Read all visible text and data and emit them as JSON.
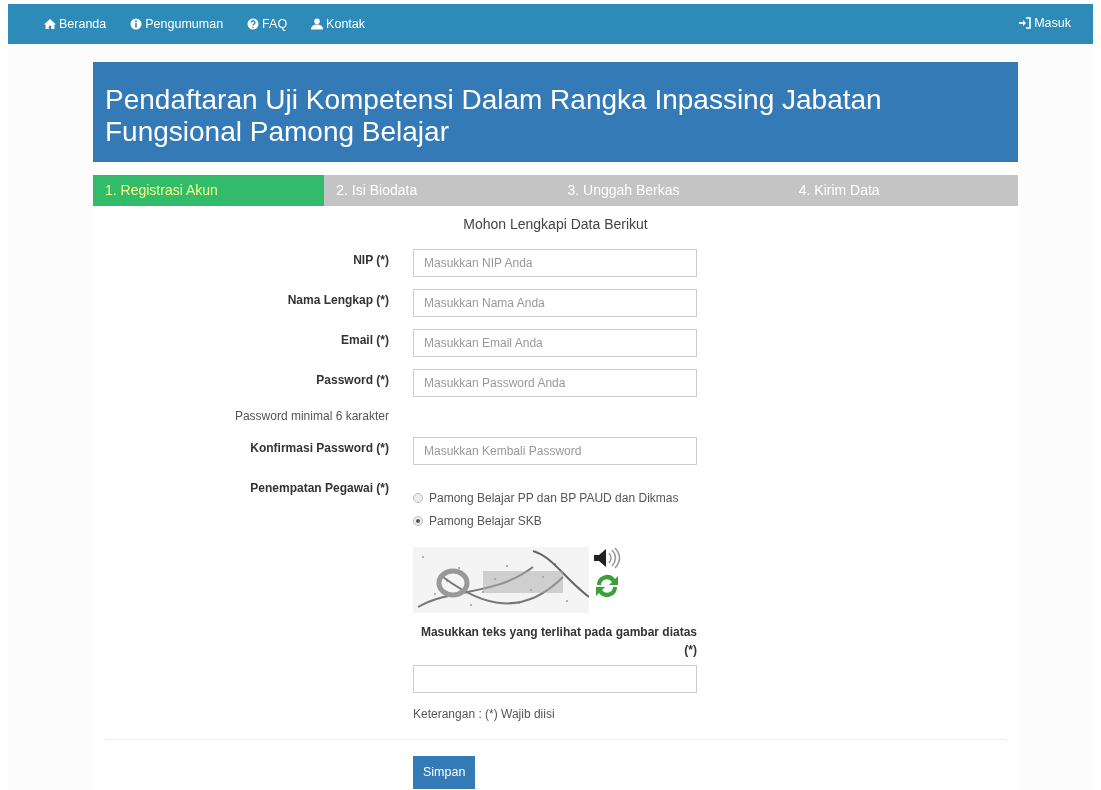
{
  "navbar": {
    "items": [
      {
        "label": "Beranda"
      },
      {
        "label": "Pengumuman"
      },
      {
        "label": "FAQ"
      },
      {
        "label": "Kontak"
      }
    ],
    "login": {
      "label": "Masuk"
    }
  },
  "header": {
    "title": "Pendaftaran Uji Kompetensi Dalam Rangka Inpassing Jabatan Fungsional Pamong Belajar"
  },
  "steps": [
    {
      "label": "1. Registrasi Akun",
      "selected": true
    },
    {
      "label": "2. Isi Biodata",
      "selected": false
    },
    {
      "label": "3. Unggah Berkas",
      "selected": false
    },
    {
      "label": "4. Kirim Data",
      "selected": false
    }
  ],
  "form": {
    "heading": "Mohon Lengkapi Data Berikut",
    "fields": [
      {
        "kind": "input",
        "label": "NIP (*)",
        "placeholder": "Masukkan NIP Anda"
      },
      {
        "kind": "input",
        "label": "Nama Lengkap (*)",
        "placeholder": "Masukkan Nama Anda"
      },
      {
        "kind": "input",
        "label": "Email (*)",
        "placeholder": "Masukkan Email Anda"
      },
      {
        "kind": "input",
        "label": "Password (*)",
        "placeholder": "Masukkan Password Anda"
      },
      {
        "kind": "note",
        "text": "Password minimal 6 karakter"
      },
      {
        "kind": "input",
        "label": "Konfirmasi Password (*)",
        "placeholder": "Masukkan Kembali Password"
      },
      {
        "kind": "radio",
        "label": "Penempatan Pegawai (*)",
        "options": [
          {
            "label": "Pamong Belajar PP dan BP PAUD dan Dikmas",
            "selected": false
          },
          {
            "label": "Pamong Belajar SKB",
            "selected": true
          }
        ]
      }
    ],
    "captcha": {
      "kind": "picture",
      "prompt": "Masukkan teks yang terlihat pada gambar diatas (*)"
    },
    "legend": "Keterangan : (*) Wajib diisi",
    "submit": "Simpan"
  }
}
